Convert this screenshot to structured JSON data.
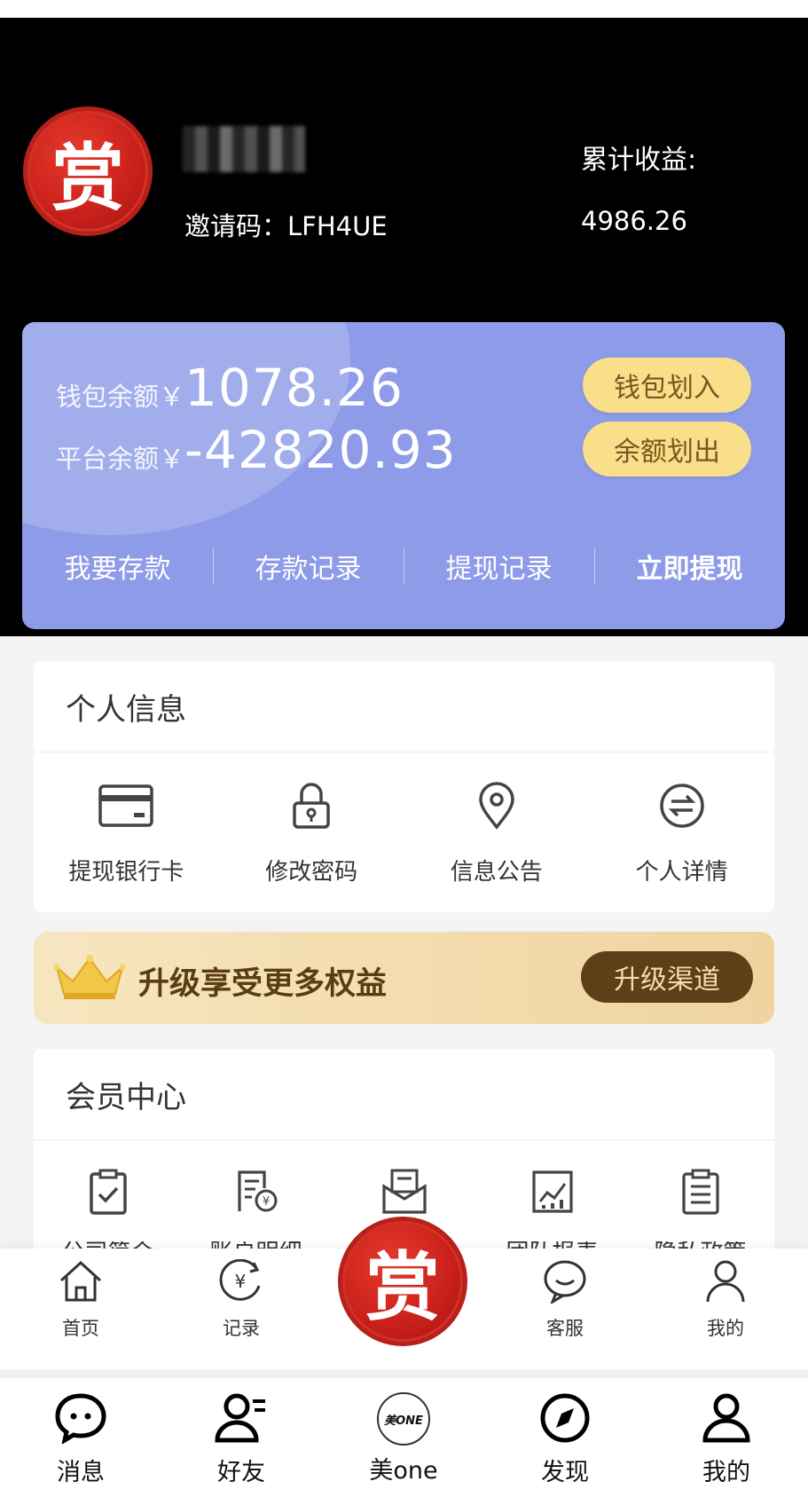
{
  "profile": {
    "logo_text": "赏",
    "invite_code": "邀请码：LFH4UE",
    "earnings_label": "累计收益:",
    "earnings_value": "4986.26"
  },
  "wallet": {
    "wallet_label": "钱包余额￥",
    "wallet_value": "1078.26",
    "platform_label": "平台余额￥",
    "platform_value": "-42820.93",
    "btn_in": "钱包划入",
    "btn_out": "余额划出",
    "links": [
      "我要存款",
      "存款记录",
      "提现记录",
      "立即提现"
    ]
  },
  "personal": {
    "title": "个人信息",
    "items": [
      {
        "label": "提现银行卡",
        "icon": "bank-card-icon"
      },
      {
        "label": "修改密码",
        "icon": "lock-icon"
      },
      {
        "label": "信息公告",
        "icon": "location-pin-icon"
      },
      {
        "label": "个人详情",
        "icon": "exchange-icon"
      }
    ]
  },
  "upgrade": {
    "title": "升级享受更多权益",
    "button": "升级渠道"
  },
  "member": {
    "title": "会员中心",
    "items": [
      {
        "label": "公司简介",
        "icon": "clipboard-check-icon"
      },
      {
        "label": "账户明细",
        "icon": "bill-icon"
      },
      {
        "label": "",
        "icon": "mail-icon"
      },
      {
        "label": "团队报表",
        "icon": "report-chart-icon"
      },
      {
        "label": "隐私政策",
        "icon": "list-clipboard-icon"
      }
    ]
  },
  "tabbar": {
    "items": [
      "首页",
      "记录",
      "客服",
      "我的"
    ],
    "center_logo": "赏"
  },
  "wechat_bar": {
    "items": [
      "消息",
      "好友",
      "美one",
      "发现",
      "我的"
    ],
    "meone_badge": "美ONE"
  }
}
